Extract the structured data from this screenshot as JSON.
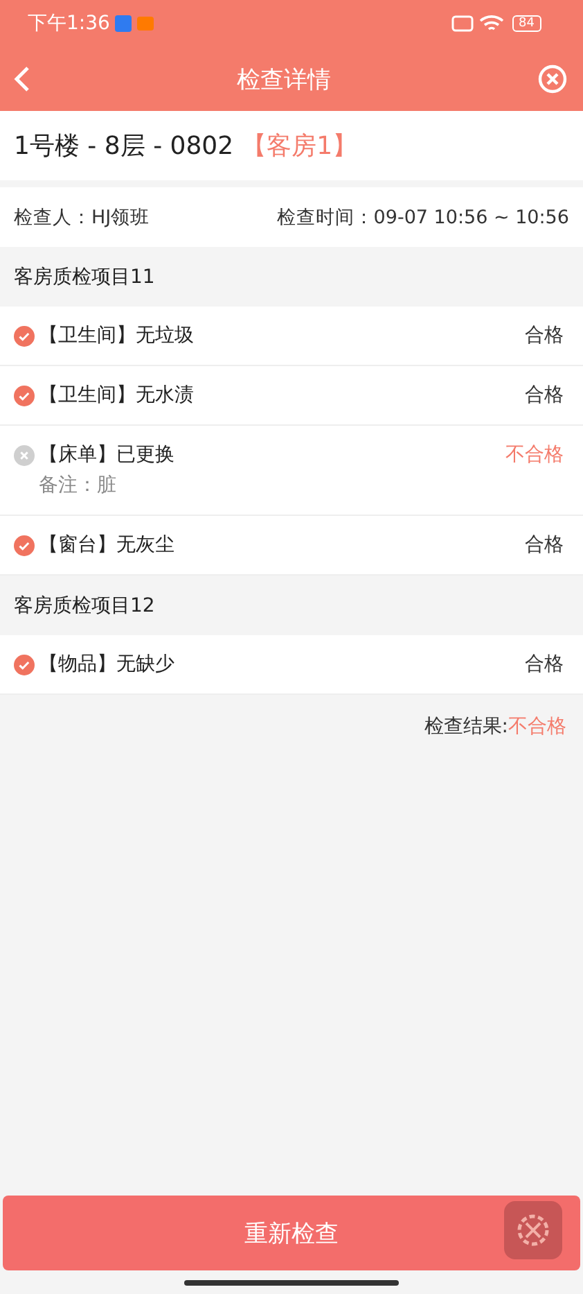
{
  "status_bar": {
    "time": "下午1:36",
    "battery": "84"
  },
  "nav": {
    "title": "检查详情"
  },
  "room": {
    "location": "1号楼 - 8层 - 0802",
    "tag": "【客房1】"
  },
  "info": {
    "inspector": "检查人：HJ领班",
    "time": "检查时间：09-07 10:56 ~ 10:56"
  },
  "sections": [
    {
      "title": "客房质检项目11",
      "items": [
        {
          "label": "【卫生间】无垃圾",
          "passed": true,
          "result": "合格"
        },
        {
          "label": "【卫生间】无水渍",
          "passed": true,
          "result": "合格"
        },
        {
          "label": "【床单】已更换",
          "passed": false,
          "result": "不合格",
          "note": "备注：脏"
        },
        {
          "label": "【窗台】无灰尘",
          "passed": true,
          "result": "合格"
        }
      ]
    },
    {
      "title": "客房质检项目12",
      "items": [
        {
          "label": "【物品】无缺少",
          "passed": true,
          "result": "合格"
        }
      ]
    }
  ],
  "summary": {
    "label": "检查结果:",
    "value": "不合格",
    "passed": false
  },
  "button": "重新检查"
}
